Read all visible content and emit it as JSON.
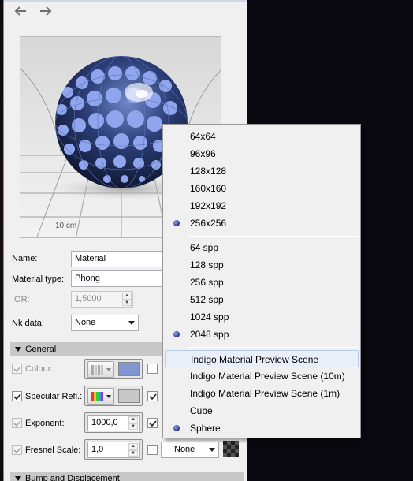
{
  "nav": {
    "back_icon": "arrow-left-icon",
    "forward_icon": "arrow-right-icon"
  },
  "preview": {
    "scale_label": "10 cm"
  },
  "fields": {
    "name_label": "Name:",
    "name_value": "Material",
    "material_type_label": "Material type:",
    "material_type_value": "Phong",
    "ior_label": "IOR:",
    "ior_value": "1,5000",
    "nk_label": "Nk data:",
    "nk_value": "None"
  },
  "sections": {
    "general": "General",
    "bump": "Bump and Displacement"
  },
  "params": {
    "colour_label": "Colour:",
    "specular_label": "Specular Refl.:",
    "exponent_label": "Exponent:",
    "exponent_value": "1000,0",
    "fresnel_label": "Fresnel Scale:",
    "fresnel_value": "1,0",
    "fresnel_combo": "None"
  },
  "menu": {
    "resolution": [
      {
        "label": "64x64",
        "selected": false
      },
      {
        "label": "96x96",
        "selected": false
      },
      {
        "label": "128x128",
        "selected": false
      },
      {
        "label": "160x160",
        "selected": false
      },
      {
        "label": "192x192",
        "selected": false
      },
      {
        "label": "256x256",
        "selected": true
      }
    ],
    "samples": [
      {
        "label": "64 spp",
        "selected": false
      },
      {
        "label": "128 spp",
        "selected": false
      },
      {
        "label": "256 spp",
        "selected": false
      },
      {
        "label": "512 spp",
        "selected": false
      },
      {
        "label": "1024 spp",
        "selected": false
      },
      {
        "label": "2048 spp",
        "selected": true
      }
    ],
    "scenes": [
      {
        "label": "Indigo Material Preview Scene",
        "selected": false,
        "highlighted": true
      },
      {
        "label": "Indigo Material Preview Scene (10m)",
        "selected": false
      },
      {
        "label": "Indigo Material Preview Scene (1m)",
        "selected": false
      },
      {
        "label": "Cube",
        "selected": false
      },
      {
        "label": "Sphere",
        "selected": true
      }
    ]
  },
  "colors": {
    "colour_swatch": "#7f96d0",
    "specular_swatch": "#c8c8c8",
    "panel_bg": "#f0f0f0",
    "menu_highlight": "#e9eff8"
  }
}
